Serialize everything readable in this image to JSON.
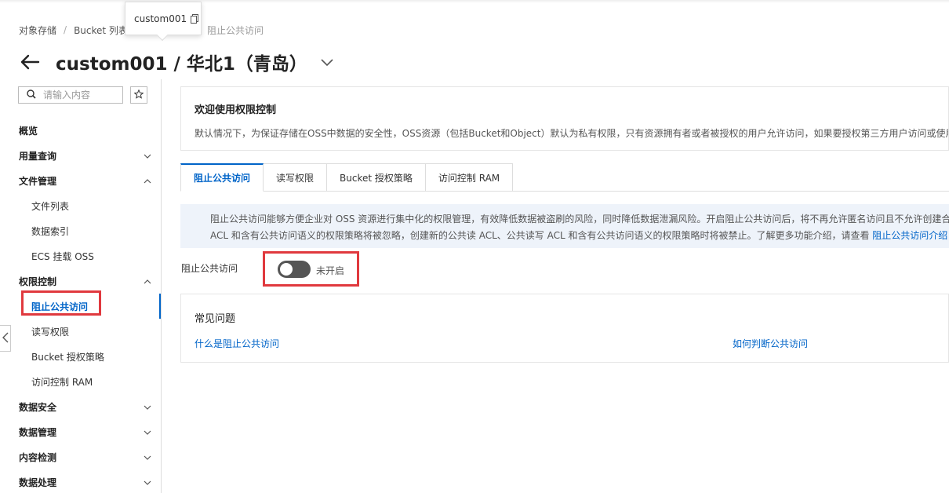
{
  "breadcrumb": {
    "items": [
      "对象存储",
      "Bucket 列表",
      "阻止公共访问"
    ]
  },
  "tooltip": {
    "text": "custom001",
    "icon": "copy-icon"
  },
  "header": {
    "title": "custom001 / 华北1（青岛）",
    "back_icon": "arrow-left-icon",
    "dropdown_icon": "chevron-down-icon"
  },
  "sidebar": {
    "search_placeholder": "请输入内容",
    "search_icon": "search-icon",
    "favorite_icon": "star-icon",
    "items": [
      {
        "label": "概览",
        "level": "top",
        "chevron": "none"
      },
      {
        "label": "用量查询",
        "level": "top",
        "chevron": "down"
      },
      {
        "label": "文件管理",
        "level": "top",
        "chevron": "up"
      },
      {
        "label": "文件列表",
        "level": "sub"
      },
      {
        "label": "数据索引",
        "level": "sub"
      },
      {
        "label": "ECS 挂载 OSS",
        "level": "sub"
      },
      {
        "label": "权限控制",
        "level": "top",
        "chevron": "up"
      },
      {
        "label": "阻止公共访问",
        "level": "sub",
        "active": true
      },
      {
        "label": "读写权限",
        "level": "sub"
      },
      {
        "label": "Bucket 授权策略",
        "level": "sub"
      },
      {
        "label": "访问控制 RAM",
        "level": "sub"
      },
      {
        "label": "数据安全",
        "level": "top",
        "chevron": "down"
      },
      {
        "label": "数据管理",
        "level": "top",
        "chevron": "down"
      },
      {
        "label": "内容检测",
        "level": "top",
        "chevron": "down"
      },
      {
        "label": "数据处理",
        "level": "top",
        "chevron": "down"
      }
    ]
  },
  "welcome": {
    "title": "欢迎使用权限控制",
    "text": "默认情况下，为保证存储在OSS中数据的安全性，OSS资源（包括Bucket和Object）默认为私有权限，只有资源拥有者或者被授权的用户允许访问，如果要授权第三方用户访问或使用自"
  },
  "tabs": [
    {
      "label": "阻止公共访问",
      "active": true
    },
    {
      "label": "读写权限",
      "active": false
    },
    {
      "label": "Bucket 授权策略",
      "active": false
    },
    {
      "label": "访问控制 RAM",
      "active": false
    }
  ],
  "notice": {
    "line1": "阻止公共访问能够方便企业对 OSS 资源进行集中化的权限管理，有效降低数据被盗刷的风险，同时降低数据泄漏风险。开启阻止公共访问后，将不再允许匿名访问且不允许创建合",
    "line2": "ACL 和含有公共访问语义的权限策略将被忽略，创建新的公共读 ACL、公共读写 ACL 和含有公共访问语义的权限策略时将被禁止。了解更多功能介绍，请查看 ",
    "link": "阻止公共访问介绍"
  },
  "block_public_access": {
    "label": "阻止公共访问",
    "enabled": false,
    "status": "未开启"
  },
  "faq": {
    "title": "常见问题",
    "links": [
      "什么是阻止公共访问",
      "如何判断公共访问"
    ]
  },
  "colors": {
    "accent": "#0064c8",
    "highlight": "#e0393e",
    "toggle_off": "#555555",
    "notice_bg": "#eef3fa"
  }
}
